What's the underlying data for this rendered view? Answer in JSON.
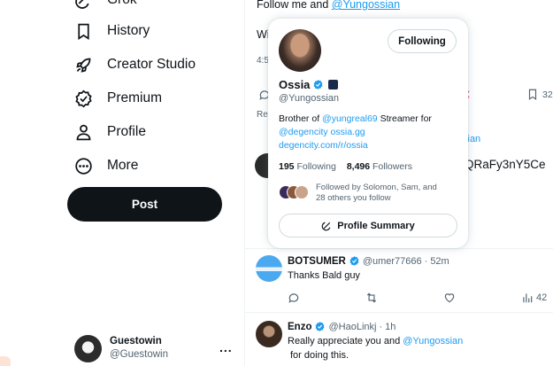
{
  "sidebar": {
    "items": [
      {
        "label": "Grok",
        "icon": "grok-icon"
      },
      {
        "label": "History",
        "icon": "bookmark-icon"
      },
      {
        "label": "Creator Studio",
        "icon": "rocket-icon"
      },
      {
        "label": "Premium",
        "icon": "verified-badge-icon"
      },
      {
        "label": "Profile",
        "icon": "person-icon"
      },
      {
        "label": "More",
        "icon": "more-circle-icon"
      }
    ],
    "post_label": "Post",
    "account": {
      "name": "Guestowin",
      "handle": "@Guestowin",
      "more": "..."
    }
  },
  "tweet": {
    "line1_prefix": "Follow me and ",
    "line1_mention": "@Yungossian",
    "line2_fragment": "Wi",
    "time_fragment": "4:5",
    "bookmark_count_fragment": "32",
    "reply_fragment": "Re"
  },
  "background_fragments": {
    "mention_fragment": "sian",
    "code_fragment": "QRaFy3nY5Ce"
  },
  "popup": {
    "following_label": "Following",
    "name": "Ossia",
    "handle": "@Yungossian",
    "bio_prefix": "Brother of ",
    "bio_mention": "@yungreal69",
    "bio_suffix": " Streamer for",
    "bio_link1": "@degencity ossia.gg",
    "bio_link2": "degencity.com/r/ossia",
    "following_count": "195",
    "following_text": "Following",
    "followers_count": "8,496",
    "followers_text": "Followers",
    "followed_by_line1": "Followed by Solomon, Sam, and",
    "followed_by_line2": "28 others you follow",
    "summary_label": "Profile Summary"
  },
  "replies": [
    {
      "name": "BOTSUMER",
      "handle": "@umer77666",
      "time": "52m",
      "text": "Thanks Bald guy",
      "views": "42"
    },
    {
      "name": "Enzo",
      "handle": "@HaoLinkj",
      "time": "1h",
      "text_prefix": "Really appreciate you and ",
      "text_mention": "@Yungossian",
      "text_line2": "for doing this."
    }
  ],
  "colors": {
    "accent": "#1d9bf0",
    "text": "#0f1419",
    "muted": "#536471",
    "border": "#eff3f4",
    "like_pink": "#f91880"
  }
}
